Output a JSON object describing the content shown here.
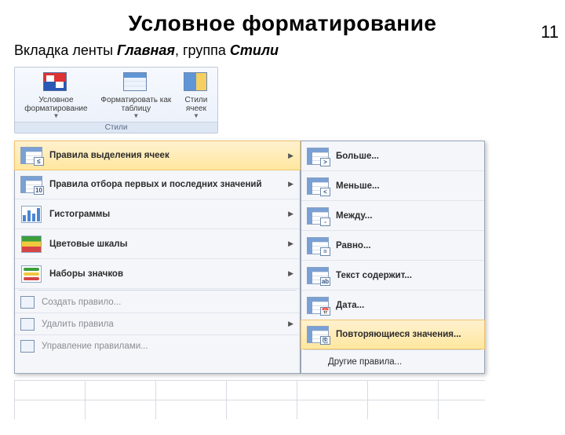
{
  "page": {
    "number": "11"
  },
  "title": "Условное форматирование",
  "subtitle_prefix": "Вкладка ленты ",
  "subtitle_em1": "Главная",
  "subtitle_mid": ", группа ",
  "subtitle_em2": "Стили",
  "ribbon": {
    "conditional_formatting": "Условное форматирование",
    "format_as_table": "Форматировать как таблицу",
    "cell_styles": "Стили ячеек",
    "group_label": "Стили"
  },
  "menu_left": {
    "highlight_rules": "Правила выделения ячеек",
    "top_bottom_rules": "Правила отбора первых и последних значений",
    "data_bars": "Гистограммы",
    "color_scales": "Цветовые шкалы",
    "icon_sets": "Наборы значков",
    "new_rule": "Создать правило...",
    "clear_rules": "Удалить правила",
    "manage_rules": "Управление правилами..."
  },
  "menu_right": {
    "greater": "Больше...",
    "less": "Меньше...",
    "between": "Между...",
    "equal": "Равно...",
    "text_contains": "Текст содержит...",
    "date": "Дата...",
    "duplicate": "Повторяющиеся значения...",
    "other_rules": "Другие правила..."
  }
}
